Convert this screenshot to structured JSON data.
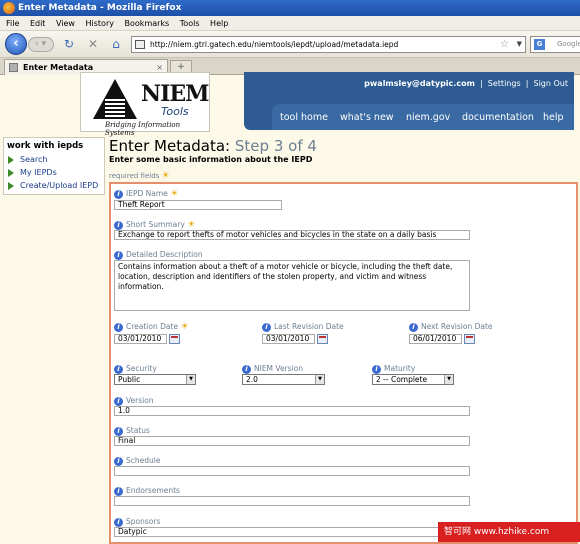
{
  "window": {
    "title": "Enter Metadata - Mozilla Firefox"
  },
  "menu": [
    "File",
    "Edit",
    "View",
    "History",
    "Bookmarks",
    "Tools",
    "Help"
  ],
  "address": {
    "url": "http://niem.gtri.gatech.edu/niemtools/iepdt/upload/metadata.iepd",
    "search_placeholder": "Google"
  },
  "tab": {
    "label": "Enter Metadata",
    "new_tab": "+"
  },
  "logo": {
    "name": "NIEM",
    "sub": "Tools",
    "tagline": "Bridging Information Systems"
  },
  "header": {
    "user_email": "pwalmsley@datypic.com",
    "settings": "Settings",
    "signout": "Sign Out",
    "sep1": "|",
    "sep2": "|",
    "nav": [
      "tool home",
      "what's new",
      "niem.gov",
      "documentation",
      "help"
    ]
  },
  "sidebar": {
    "title": "work with iepds",
    "items": [
      "Search",
      "My IEPDs",
      "Create/Upload IEPD"
    ]
  },
  "page": {
    "title": "Enter Metadata:",
    "step": "Step 3 of 4",
    "subtitle": "Enter some basic information about the IEPD",
    "required": "required fields"
  },
  "form": {
    "iepd_name": {
      "label": "IEPD Name",
      "value": "Theft Report"
    },
    "short_summary": {
      "label": "Short Summary",
      "value": "Exchange to report thefts of motor vehicles and bicycles in the state on a daily basis"
    },
    "detailed_description": {
      "label": "Detailed Description",
      "value": "Contains information about a theft of a motor vehicle or bicycle, including the theft date, location, description and identifiers of the stolen property, and victim and witness information."
    },
    "creation_date": {
      "label": "Creation Date",
      "value": "03/01/2010"
    },
    "last_revision_date": {
      "label": "Last Revision Date",
      "value": "03/01/2010"
    },
    "next_revision_date": {
      "label": "Next Revision Date",
      "value": "06/01/2010"
    },
    "security": {
      "label": "Security",
      "value": "Public"
    },
    "niem_version": {
      "label": "NIEM Version",
      "value": "2.0"
    },
    "maturity": {
      "label": "Maturity",
      "value": "2 -- Complete"
    },
    "version": {
      "label": "Version",
      "value": "1.0"
    },
    "status": {
      "label": "Status",
      "value": "Final"
    },
    "schedule": {
      "label": "Schedule",
      "value": ""
    },
    "endorsements": {
      "label": "Endorsements",
      "value": ""
    },
    "sponsors": {
      "label": "Sponsors",
      "value": "Datypic"
    }
  },
  "watermark": "智可网 www.hzhike.com"
}
